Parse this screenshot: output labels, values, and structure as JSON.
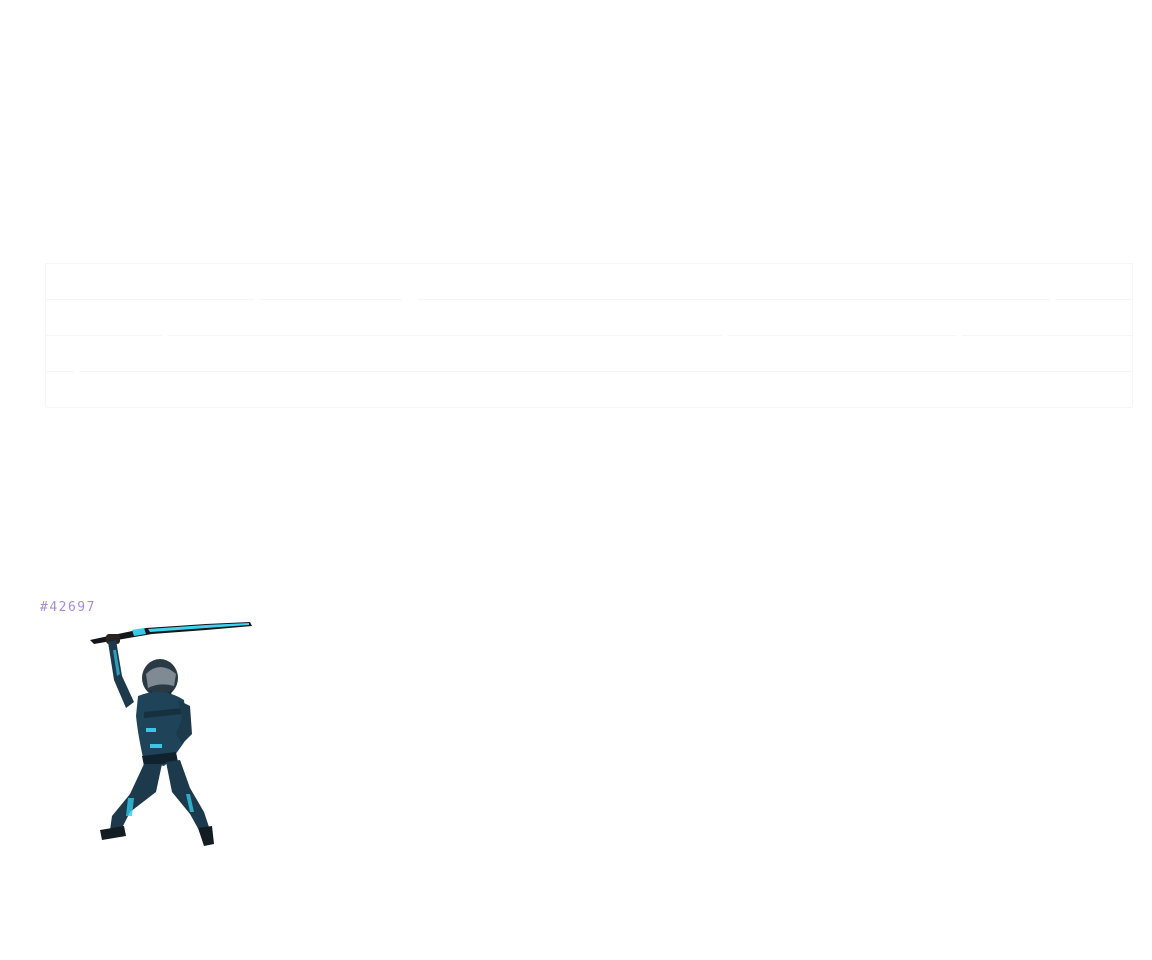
{
  "item": {
    "id_label": "#42697"
  },
  "colors": {
    "id_text": "#a98bd8",
    "grid_line": "#f6f6f6",
    "blade_glow": "#3fd3ee",
    "armor_dark": "#1c3a4c",
    "armor_accent": "#35c8e8"
  },
  "icons": {
    "character": "sword-warrior-icon"
  }
}
